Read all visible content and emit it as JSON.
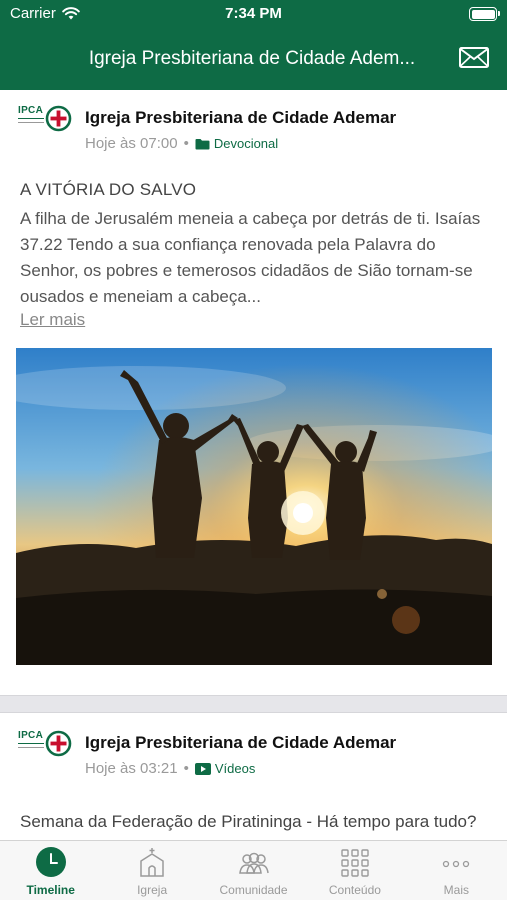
{
  "status_bar": {
    "carrier": "Carrier",
    "time": "7:34 PM"
  },
  "nav": {
    "title": "Igreja Presbiteriana de Cidade Adem...",
    "mail_icon": "envelope-icon"
  },
  "colors": {
    "brand": "#0e6b45",
    "logo_red": "#c8102e"
  },
  "posts": [
    {
      "logo_text": "IPCA",
      "author": "Igreja Presbiteriana de Cidade Ademar",
      "time": "Hoje às 07:00",
      "separator": "•",
      "category": "Devocional",
      "category_icon": "folder-icon",
      "title": "A VITÓRIA DO SALVO",
      "body": "A filha de Jerusalém meneia a cabeça por detrás de ti. Isaías 37.22 Tendo a sua confiança renovada pela Palavra do Senhor, os pobres e temerosos cidadãos de Sião tornam-se ousados e meneiam a cabeça...",
      "read_more": "Ler mais"
    },
    {
      "logo_text": "IPCA",
      "author": "Igreja Presbiteriana de Cidade Ademar",
      "time": "Hoje às 03:21",
      "separator": "•",
      "category": "Vídeos",
      "category_icon": "play-video-icon",
      "title": "Semana da Federação de Piratininga - Há tempo para tudo?"
    }
  ],
  "tabs": [
    {
      "label": "Timeline",
      "icon": "clock-icon",
      "active": true
    },
    {
      "label": "Igreja",
      "icon": "church-icon",
      "active": false
    },
    {
      "label": "Comunidade",
      "icon": "people-icon",
      "active": false
    },
    {
      "label": "Conteúdo",
      "icon": "grid-icon",
      "active": false
    },
    {
      "label": "Mais",
      "icon": "more-dots-icon",
      "active": false
    }
  ]
}
